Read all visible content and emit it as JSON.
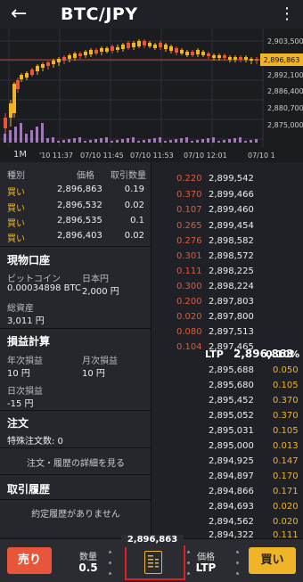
{
  "header": {
    "title": "BTC/JPY",
    "back_icon": "arrow-left-icon",
    "menu_icon": "more-vertical-icon"
  },
  "chart": {
    "price_labels": [
      "2,903,500",
      "2,896,863",
      "2,892,100",
      "2,886,400",
      "2,880,700",
      "2,875,000"
    ],
    "time_labels": [
      "'10 11:37",
      "07/10 11:45",
      "07/10 11:53",
      "07/10 12:01",
      "07/10 1"
    ],
    "timeframe": "1M"
  },
  "trades": {
    "headers": [
      "種別",
      "価格",
      "取引数量"
    ],
    "rows": [
      {
        "type": "買い",
        "price": "2,896,863",
        "qty": "0.19"
      },
      {
        "type": "買い",
        "price": "2,896,532",
        "qty": "0.02"
      },
      {
        "type": "買い",
        "price": "2,896,535",
        "qty": "0.1"
      },
      {
        "type": "買い",
        "price": "2,896,403",
        "qty": "0.02"
      }
    ]
  },
  "account": {
    "title": "現物口座",
    "btc_label": "ビットコイン",
    "btc_value": "0.00034898 BTC",
    "jpy_label": "日本円",
    "jpy_value": "2,000 円",
    "total_label": "総資産",
    "total_value": "3,011 円"
  },
  "pnl": {
    "title": "損益計算",
    "year_label": "年次損益",
    "year_value": "10 円",
    "month_label": "月次損益",
    "month_value": "10 円",
    "day_label": "日次損益",
    "day_value": "-15 円"
  },
  "orders": {
    "title": "注文",
    "special_label": "特殊注文数: 0",
    "detail_link": "注文・履歴の詳細を見る"
  },
  "history": {
    "title": "取引履歴",
    "empty_text": "約定履歴がありません"
  },
  "orderbook": {
    "asks": [
      {
        "qty": "0.220",
        "price": "2,899,542"
      },
      {
        "qty": "0.370",
        "price": "2,899,466"
      },
      {
        "qty": "0.107",
        "price": "2,899,460"
      },
      {
        "qty": "0.265",
        "price": "2,899,454"
      },
      {
        "qty": "0.276",
        "price": "2,898,582"
      },
      {
        "qty": "0.301",
        "price": "2,898,572"
      },
      {
        "qty": "0.111",
        "price": "2,898,225"
      },
      {
        "qty": "0.300",
        "price": "2,898,224"
      },
      {
        "qty": "0.200",
        "price": "2,897,803"
      },
      {
        "qty": "0.020",
        "price": "2,897,800"
      },
      {
        "qty": "0.080",
        "price": "2,897,513"
      },
      {
        "qty": "0.104",
        "price": "2,897,465"
      }
    ],
    "ltp_label": "LTP",
    "ltp_price": "2,896,863",
    "ltp_pct": "0.10%",
    "bids": [
      {
        "price": "2,895,688",
        "qty": "0.050"
      },
      {
        "price": "2,895,680",
        "qty": "0.105"
      },
      {
        "price": "2,895,452",
        "qty": "0.370"
      },
      {
        "price": "2,895,052",
        "qty": "0.370"
      },
      {
        "price": "2,895,031",
        "qty": "0.105"
      },
      {
        "price": "2,895,000",
        "qty": "0.013"
      },
      {
        "price": "2,894,925",
        "qty": "0.147"
      },
      {
        "price": "2,894,897",
        "qty": "0.170"
      },
      {
        "price": "2,894,866",
        "qty": "0.171"
      },
      {
        "price": "2,894,693",
        "qty": "0.020"
      },
      {
        "price": "2,894,562",
        "qty": "0.020"
      },
      {
        "price": "2,894,322",
        "qty": "0.111"
      }
    ]
  },
  "bottom": {
    "sell_label": "売り",
    "buy_label": "買い",
    "qty_label": "数量",
    "qty_value": "0.5",
    "price_label": "価格",
    "price_value": "LTP",
    "mid_price": "2,896,863",
    "book_icon": "orderbook-icon"
  },
  "colors": {
    "sell": "#e8553a",
    "buy": "#f0b428",
    "highlight": "#e01f22"
  }
}
